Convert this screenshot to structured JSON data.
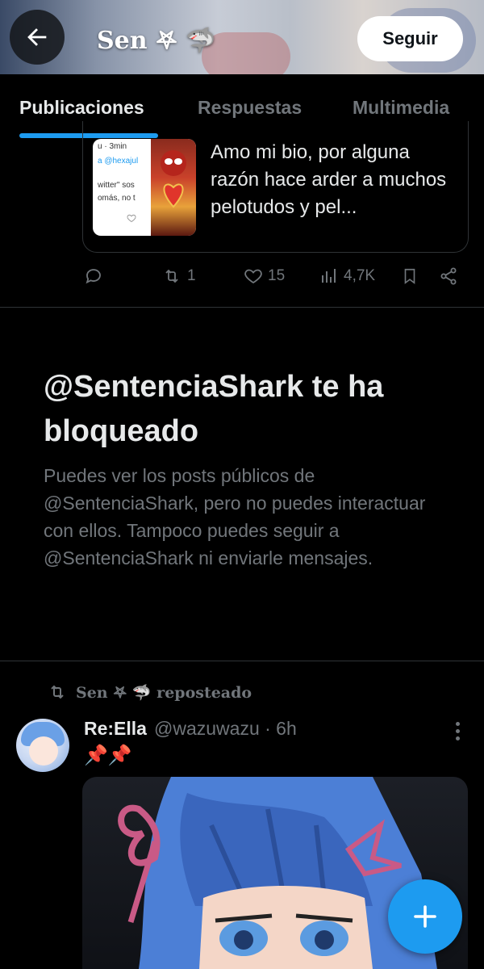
{
  "header": {
    "title": "Sen 𖤐 🦈",
    "follow_label": "Seguir"
  },
  "tabs": [
    {
      "label": "Publicaciones",
      "active": true
    },
    {
      "label": "Respuestas",
      "active": false
    },
    {
      "label": "Multimedia",
      "active": false
    }
  ],
  "quoted_post": {
    "thumb_time": "u · 3min",
    "thumb_mention": "a @hexajul",
    "thumb_line1": "witter\" sos",
    "thumb_line2": "omás, no t",
    "text": "Amo mi bio, por alguna razón hace arder a muchos pelotudos y pel..."
  },
  "actions": {
    "reposts": "1",
    "likes": "15",
    "views": "4,7K"
  },
  "blocked_notice": {
    "title": "@SentenciaShark te ha bloqueado",
    "description": "Puedes ver los posts públicos de @SentenciaShark, pero no puedes interactuar con ellos. Tampoco puedes seguir a @SentenciaShark ni enviarle mensajes."
  },
  "repost": {
    "label": "Sen 𖤐 🦈 reposteado"
  },
  "post": {
    "author": "Re:Ella",
    "handle": "@wazuwazu · 6h",
    "body": "📌📌"
  },
  "colors": {
    "accent": "#1d9bf0",
    "background": "#000000",
    "text_primary": "#e7e9ea",
    "text_secondary": "#71767b",
    "border": "#2f3336"
  },
  "icons": {
    "back": "arrow-left-icon",
    "reply": "comment-icon",
    "repost": "repost-icon",
    "like": "heart-icon",
    "views": "bar-chart-icon",
    "bookmark": "bookmark-icon",
    "share": "share-icon",
    "more": "more-vertical-icon",
    "compose": "plus-icon"
  }
}
